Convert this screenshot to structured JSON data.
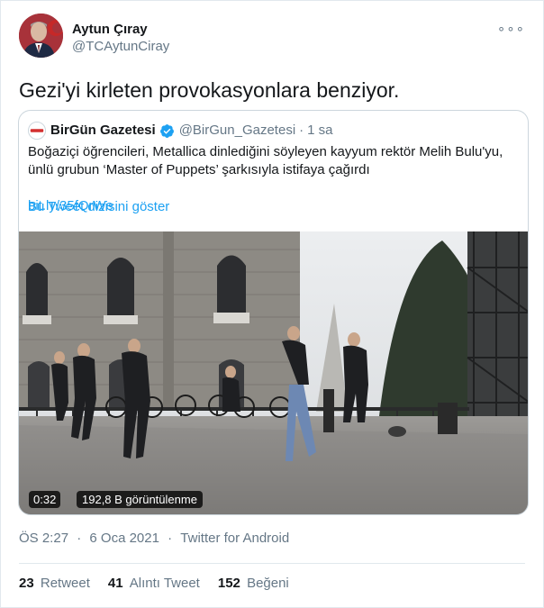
{
  "author": {
    "name": "Aytun Çıray",
    "handle": "@TCAytunCiray"
  },
  "more_icon": "ellipsis-icon",
  "tweet": {
    "text": "Gezi'yi kirleten provokasyonlara benziyor."
  },
  "quoted": {
    "name": "BirGün Gazetesi",
    "avatar_text": "BirGün",
    "handle": "@BirGun_Gazetesi",
    "dot": "·",
    "time": "1 sa",
    "text": "Boğaziçi öğrencileri, Metallica dinlediğini söyleyen kayyum rektör Melih Bulu'yu, ünlü grubun ‘Master of Puppets’ şarkısıyla istifaya çağırdı",
    "link": "bit.ly/35fQrWe",
    "thread_link": "Bu Tweet dizisini göster",
    "video": {
      "duration": "0:32",
      "views": "192,8 B görüntülenme"
    }
  },
  "meta": {
    "time": "ÖS 2:27",
    "sep1": "·",
    "date": "6 Oca 2021",
    "sep2": "·",
    "source": "Twitter for Android"
  },
  "stats": {
    "retweets_count": "23",
    "retweets_label": "Retweet",
    "quotes_count": "41",
    "quotes_label": "Alıntı Tweet",
    "likes_count": "152",
    "likes_label": "Beğeni"
  },
  "colors": {
    "link": "#1da1f2",
    "verified": "#1da1f2",
    "secondary_text": "#657786",
    "border": "#e1e8ed"
  }
}
